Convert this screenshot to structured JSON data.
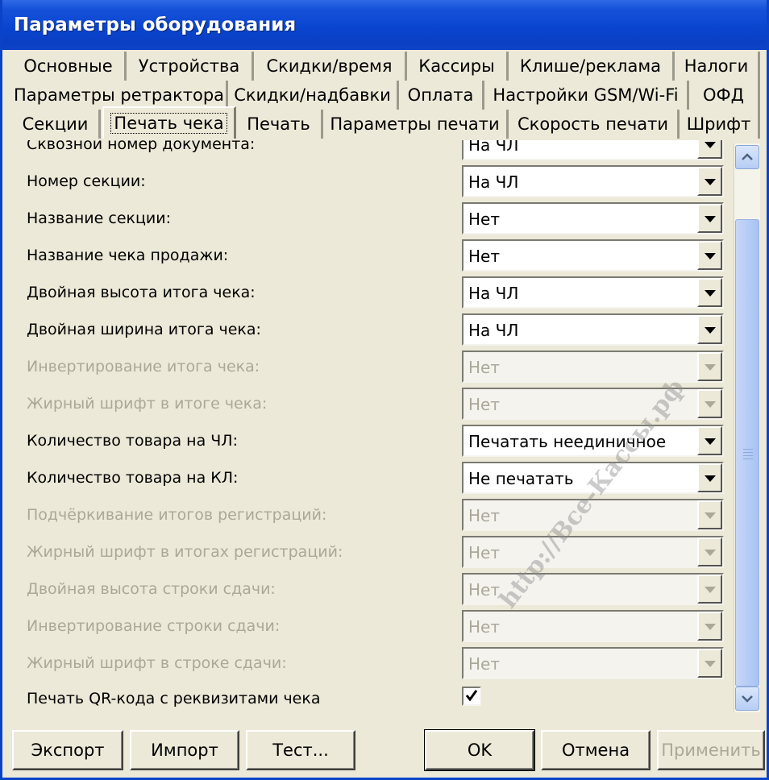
{
  "window": {
    "title": "Параметры оборудования"
  },
  "tabs": {
    "row1": [
      "Основные",
      "Устройства",
      "Скидки/время",
      "Кассиры",
      "Клише/реклама",
      "Налоги"
    ],
    "row2": [
      "Параметры ретрактора",
      "Скидки/надбавки",
      "Оплата",
      "Настройки GSM/Wi-Fi",
      "ОФД"
    ],
    "row3": [
      "Секции",
      "Печать чека",
      "Печать",
      "Параметры печати",
      "Скорость печати",
      "Шрифт"
    ],
    "active": "Печать чека"
  },
  "settings": [
    {
      "label": "Сквозной номер документа:",
      "value": "На ЧЛ",
      "enabled": true
    },
    {
      "label": "Номер секции:",
      "value": "На ЧЛ",
      "enabled": true
    },
    {
      "label": "Название секции:",
      "value": "Нет",
      "enabled": true
    },
    {
      "label": "Название чека продажи:",
      "value": "Нет",
      "enabled": true
    },
    {
      "label": "Двойная высота итога чека:",
      "value": "На ЧЛ",
      "enabled": true
    },
    {
      "label": "Двойная ширина итога чека:",
      "value": "На ЧЛ",
      "enabled": true
    },
    {
      "label": "Инвертирование итога чека:",
      "value": "Нет",
      "enabled": false
    },
    {
      "label": "Жирный шрифт в итоге чека:",
      "value": "Нет",
      "enabled": false
    },
    {
      "label": "Количество товара на ЧЛ:",
      "value": "Печатать неединичное",
      "enabled": true
    },
    {
      "label": "Количество товара на КЛ:",
      "value": "Не печатать",
      "enabled": true
    },
    {
      "label": "Подчёркивание итогов регистраций:",
      "value": "Нет",
      "enabled": false
    },
    {
      "label": "Жирный шрифт в итогах регистраций:",
      "value": "Нет",
      "enabled": false
    },
    {
      "label": "Двойная высота строки сдачи:",
      "value": "Нет",
      "enabled": false
    },
    {
      "label": "Инвертирование строки сдачи:",
      "value": "Нет",
      "enabled": false
    },
    {
      "label": "Жирный шрифт в строке сдачи:",
      "value": "Нет",
      "enabled": false
    }
  ],
  "qr_option": {
    "label": "Печать QR-кода с реквизитами чека",
    "checked": true
  },
  "buttons": {
    "export": "Экспорт",
    "import": "Импорт",
    "test": "Тест...",
    "ok": "OK",
    "cancel": "Отмена",
    "apply": "Применить"
  },
  "watermark": "http://Все-Кассы.рф",
  "colors": {
    "title_bar": "#0a45cf",
    "dialog_bg": "#ece9d8",
    "disabled_text": "#aca899"
  },
  "icons": [
    "dropdown-arrow-icon",
    "checkmark-icon",
    "scroll-up-icon",
    "scroll-down-icon",
    "scroll-grip-icon"
  ]
}
